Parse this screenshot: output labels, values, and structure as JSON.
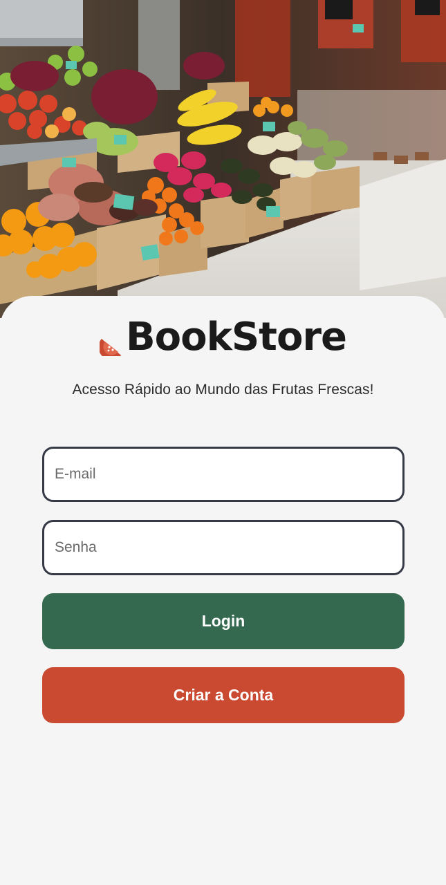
{
  "brand": {
    "name": "BookStore",
    "tagline": "Acesso Rápido ao Mundo das Frutas Frescas!",
    "icon": "watermelon-slice-icon"
  },
  "hero": {
    "image": "fruit-market-stall-photo"
  },
  "form": {
    "email_placeholder": "E-mail",
    "email_value": "",
    "password_placeholder": "Senha",
    "password_value": ""
  },
  "actions": {
    "login_label": "Login",
    "signup_label": "Criar a Conta"
  },
  "colors": {
    "login_button": "#346950",
    "signup_button": "#c94a30",
    "field_border": "#353a46",
    "background": "#f5f5f5"
  }
}
